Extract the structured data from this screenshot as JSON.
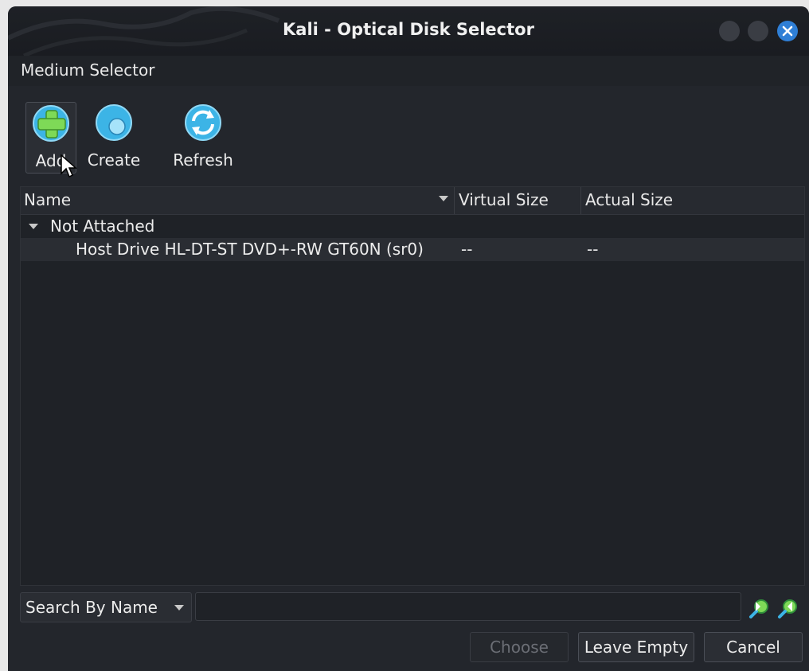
{
  "window": {
    "title": "Kali - Optical Disk Selector"
  },
  "menu": {
    "medium_selector": "Medium Selector"
  },
  "toolbar": {
    "add_label": "Add",
    "create_label": "Create",
    "refresh_label": "Refresh"
  },
  "table": {
    "headers": {
      "name": "Name",
      "virtual_size": "Virtual Size",
      "actual_size": "Actual Size"
    },
    "group_label": "Not Attached",
    "items": [
      {
        "name": "Host Drive HL-DT-ST DVD+-RW GT60N (sr0)",
        "virtual_size": "--",
        "actual_size": "--"
      }
    ]
  },
  "search": {
    "mode": "Search By Name",
    "value": ""
  },
  "buttons": {
    "choose": "Choose",
    "leave_empty": "Leave Empty",
    "cancel": "Cancel"
  },
  "colors": {
    "window_bg": "#23262c",
    "accent_blue": "#2f7fd6",
    "icon_cyan": "#3cb4e6",
    "icon_green": "#7ed957"
  },
  "icons": {
    "add": "disk-add-icon",
    "create": "disk-create-icon",
    "refresh": "refresh-icon",
    "search_prev": "search-prev-icon",
    "search_next": "search-next-icon",
    "close": "close-icon"
  }
}
